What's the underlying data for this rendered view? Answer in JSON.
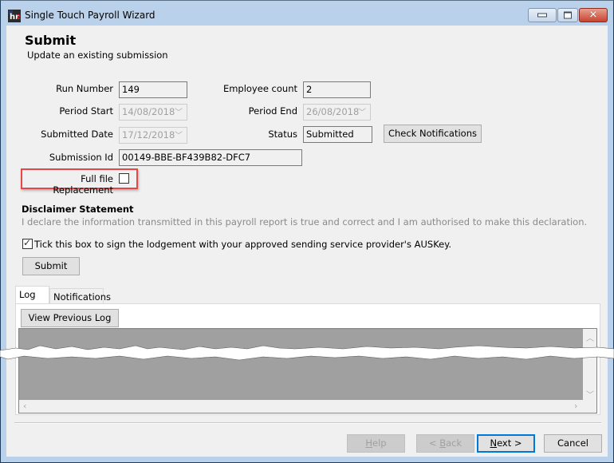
{
  "window": {
    "title": "Single Touch Payroll Wizard",
    "controls": {
      "minimize": "minimize",
      "maximize": "maximize",
      "close": "close"
    }
  },
  "page": {
    "title": "Submit",
    "subtitle": "Update an existing submission"
  },
  "form": {
    "run_number": {
      "label": "Run Number",
      "value": "149"
    },
    "employee_count": {
      "label": "Employee count",
      "value": "2"
    },
    "period_start": {
      "label": "Period Start",
      "value": "14/08/2018"
    },
    "period_end": {
      "label": "Period End",
      "value": "26/08/2018"
    },
    "submitted_date": {
      "label": "Submitted Date",
      "value": "17/12/2018"
    },
    "status": {
      "label": "Status",
      "value": "Submitted"
    },
    "submission_id": {
      "label": "Submission Id",
      "value": "00149-BBE-BF439B82-DFC7"
    },
    "full_file_replacement": {
      "label": "Full file Replacement",
      "checked": false
    },
    "check_notifications_label": "Check Notifications"
  },
  "disclaimer": {
    "title": "Disclaimer Statement",
    "text": "I declare the information transmitted in this payroll report is true and correct and I am authorised to make this declaration.",
    "ausKey_checkbox": {
      "label": "Tick this box to sign the lodgement with your approved sending service provider's AUSKey.",
      "checked": true
    },
    "submit_label": "Submit"
  },
  "tabs": [
    {
      "label": "Log",
      "active": true
    },
    {
      "label": "Notifications",
      "active": false
    }
  ],
  "log": {
    "view_previous_label": "View Previous Log"
  },
  "footer": {
    "help": {
      "pre": "",
      "accel": "H",
      "post": "elp"
    },
    "back": {
      "pre": "< ",
      "accel": "B",
      "post": "ack"
    },
    "next": {
      "pre": "",
      "accel": "N",
      "post": "ext >"
    },
    "cancel": "Cancel"
  },
  "colors": {
    "accent": "#0078d7",
    "highlight_box": "#e8474a",
    "frame": "#b9d1ea"
  }
}
